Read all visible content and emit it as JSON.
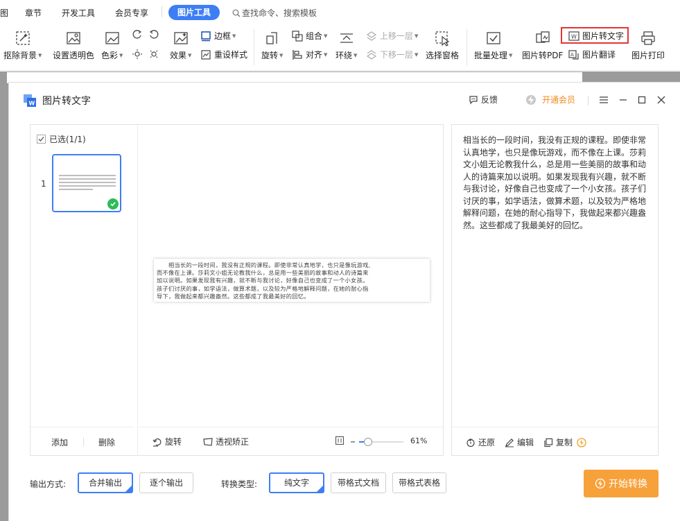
{
  "menu": {
    "items": [
      "图",
      "章节",
      "开发工具",
      "会员专享"
    ],
    "active_tab": "图片工具",
    "search_placeholder": "查找命令、搜索模板"
  },
  "ribbon": {
    "remove_bg": "抠除背景",
    "set_transparent": "设置透明色",
    "color": "色彩",
    "effect": "效果",
    "border": "边框",
    "reset_style": "重设样式",
    "rotate": "旋转",
    "group": "组合",
    "align": "对齐",
    "wrap": "环绕",
    "move_up": "上移一层",
    "move_down": "下移一层",
    "selection_pane": "选择窗格",
    "batch": "批量处理",
    "to_pdf": "图片转PDF",
    "to_text": "图片转文字",
    "translate": "图片翻译",
    "print": "图片打印"
  },
  "dialog": {
    "title": "图片转文字",
    "feedback": "反馈",
    "vip": "开通会员",
    "selected": "已选(1/1)",
    "page_number": "1",
    "add": "添加",
    "delete": "删除",
    "rotate": "旋转",
    "perspective": "透视矫正",
    "zoom": "61%",
    "zoom_fraction": 0.2,
    "preview_lines": [
      "　　相当长的一段时间，我没有正规的课程。即使非常认真地学，也只是像玩游戏,",
      "而不像在上课。莎莉文小姐无论教我什么，总是用一些美丽的故事和动人的诗篇来",
      "加以说明。如果发现我有兴趣，就不断与我讨论，好像自己也变成了一个小女孩。",
      "孩子们讨厌的事，如学语法，做算术题，以及较为严格地解释问题，在她的耐心指",
      "导下，我做起来都兴趣盎然。这些都成了我最美好的回忆。"
    ],
    "ocr_text": "相当长的一段时间，我没有正规的课程。即使非常认真地学，也只是像玩游戏，而不像在上课。莎莉文小姐无论教我什么，总是用一些美丽的故事和动人的诗篇来加以说明。如果发现我有兴趣，就不断与我讨论，好像自己也变成了一个小女孩。孩子们讨厌的事，如学语法，做算术题，以及较为严格地解释问题，在她的耐心指导下，我做起来都兴趣盎然。这些都成了我最美好的回忆。",
    "restore": "还原",
    "edit": "编辑",
    "copy": "复制",
    "output_label": "输出方式:",
    "output_merge": "合并输出",
    "output_each": "逐个输出",
    "convert_label": "转换类型:",
    "type_plain": "纯文字",
    "type_doc": "带格式文档",
    "type_table": "带格式表格",
    "start": "开始转换"
  },
  "colors": {
    "accent": "#3d7ef5",
    "start_button": "#f7a13a",
    "vip": "#f08a1c",
    "highlight": "#e53333",
    "success": "#2dbb5a"
  }
}
